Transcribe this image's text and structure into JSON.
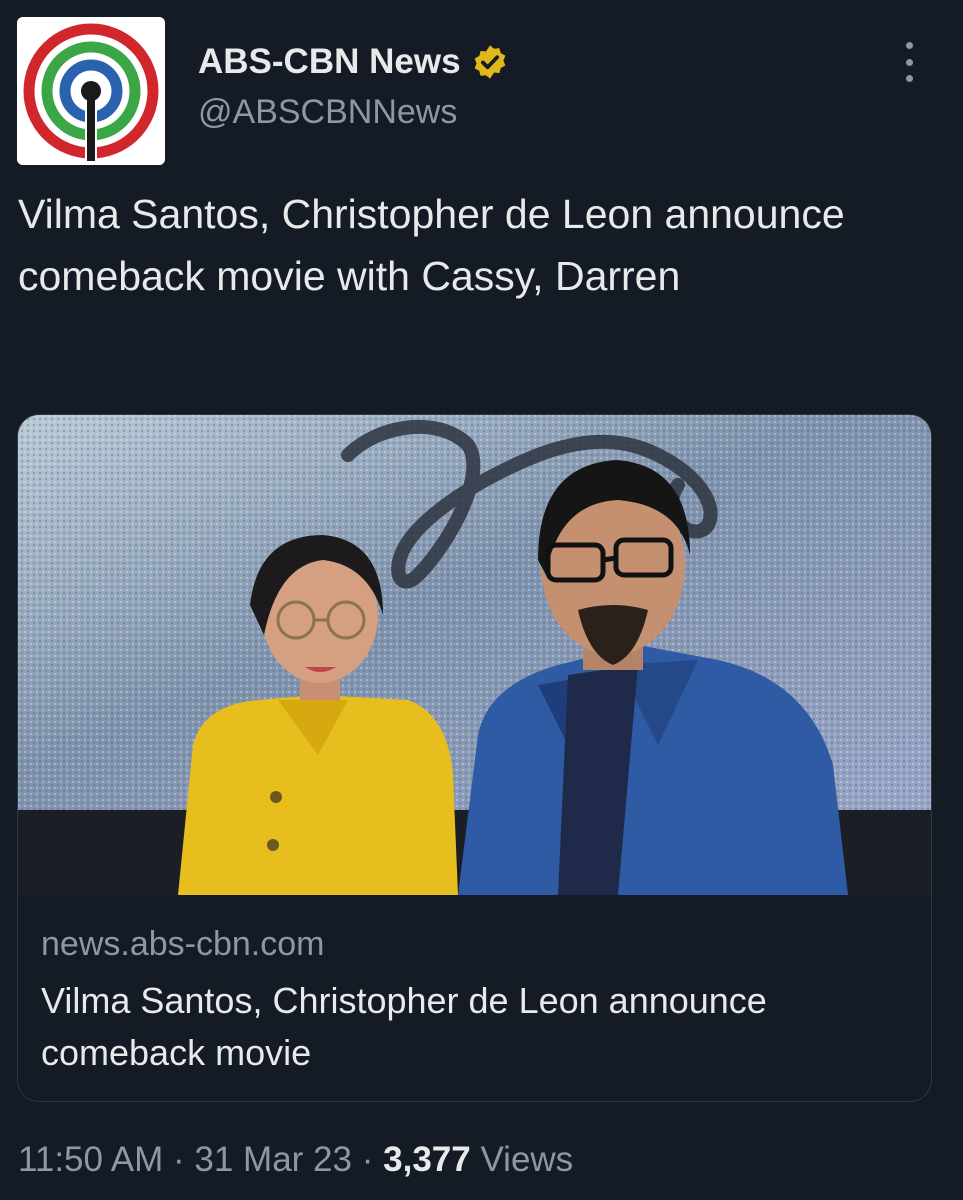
{
  "account": {
    "display_name": "ABS-CBN News",
    "handle": "@ABSCBNNews",
    "avatar_icon": "abs-cbn-logo-icon",
    "verified_icon": "verified-badge-icon",
    "verified_color": "#e2b719"
  },
  "tweet": {
    "text": "Vilma Santos, Christopher de Leon announce comeback movie with Cassy, Darren"
  },
  "link_card": {
    "domain": "news.abs-cbn.com",
    "title": "Vilma Santos, Christopher de Leon announce comeback movie"
  },
  "meta": {
    "time": "11:50 AM",
    "separator": "·",
    "date": "31 Mar 23",
    "views_count": "3,377",
    "views_label": "Views"
  },
  "colors": {
    "background": "#141b24",
    "text_primary": "#e7e9ea",
    "text_secondary": "#8b98a5",
    "logo_red": "#d2262d",
    "logo_green": "#3aa645",
    "logo_blue": "#2a62b0"
  }
}
